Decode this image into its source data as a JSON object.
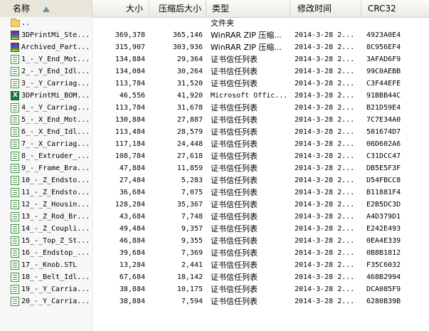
{
  "columns": {
    "name": "名称",
    "size": "大小",
    "packed": "压缩后大小",
    "type": "类型",
    "modified": "修改时间",
    "crc": "CRC32"
  },
  "rows": [
    {
      "name": "..",
      "size": "",
      "packed": "",
      "type": "文件夹",
      "modified": "",
      "crc": "",
      "icon": "folder-icon"
    },
    {
      "name": "3DPrintMi_Ste...",
      "size": "369,378",
      "packed": "365,146",
      "type": "WinRAR ZIP 压缩...",
      "modified": "2014-3-28 2...",
      "crc": "4923A0E4",
      "icon": "winrar-archive-icon"
    },
    {
      "name": "Archived_Part...",
      "size": "315,907",
      "packed": "303,936",
      "type": "WinRAR ZIP 压缩...",
      "modified": "2014-3-28 2...",
      "crc": "8C956EF4",
      "icon": "winrar-archive-icon"
    },
    {
      "name": "1_-_Y_End_Mot...",
      "size": "134,884",
      "packed": "29,364",
      "type": "证书信任列表",
      "modified": "2014-3-28 2...",
      "crc": "3AFAD6F9",
      "icon": "certificate-list-icon"
    },
    {
      "name": "2_-_Y_End_Idl...",
      "size": "134,084",
      "packed": "30,264",
      "type": "证书信任列表",
      "modified": "2014-3-28 2...",
      "crc": "99C0AEBB",
      "icon": "certificate-list-icon"
    },
    {
      "name": "3_-_Y_Carriag...",
      "size": "113,784",
      "packed": "31,520",
      "type": "证书信任列表",
      "modified": "2014-3-28 2...",
      "crc": "C3F44EFE",
      "icon": "certificate-list-icon"
    },
    {
      "name": "3DPrintMi_BOM...",
      "size": "46,556",
      "packed": "41,920",
      "type": "Microsoft Offic...",
      "modified": "2014-3-28 2...",
      "crc": "91BBB44C",
      "icon": "excel-file-icon"
    },
    {
      "name": "4_-_Y_Carriag...",
      "size": "113,784",
      "packed": "31,678",
      "type": "证书信任列表",
      "modified": "2014-3-28 2...",
      "crc": "B21D59E4",
      "icon": "certificate-list-icon"
    },
    {
      "name": "5_-_X_End_Mot...",
      "size": "130,884",
      "packed": "27,887",
      "type": "证书信任列表",
      "modified": "2014-3-28 2...",
      "crc": "7C7E34A0",
      "icon": "certificate-list-icon"
    },
    {
      "name": "6_-_X_End_Idl...",
      "size": "113,484",
      "packed": "28,579",
      "type": "证书信任列表",
      "modified": "2014-3-28 2...",
      "crc": "501674D7",
      "icon": "certificate-list-icon"
    },
    {
      "name": "7_-_X_Carriag...",
      "size": "117,184",
      "packed": "24,448",
      "type": "证书信任列表",
      "modified": "2014-3-28 2...",
      "crc": "06D602A6",
      "icon": "certificate-list-icon"
    },
    {
      "name": "8_-_Extruder_...",
      "size": "108,784",
      "packed": "27,618",
      "type": "证书信任列表",
      "modified": "2014-3-28 2...",
      "crc": "C31DCC47",
      "icon": "certificate-list-icon"
    },
    {
      "name": "9_-_Frame_Bra...",
      "size": "47,884",
      "packed": "11,859",
      "type": "证书信任列表",
      "modified": "2014-3-28 2...",
      "crc": "DB5E5F3F",
      "icon": "certificate-list-icon"
    },
    {
      "name": "10_-_Z_Endsto...",
      "size": "27,484",
      "packed": "5,283",
      "type": "证书信任列表",
      "modified": "2014-3-28 2...",
      "crc": "D54FBCC8",
      "icon": "certificate-list-icon"
    },
    {
      "name": "11_-_Z_Endsto...",
      "size": "36,684",
      "packed": "7,075",
      "type": "证书信任列表",
      "modified": "2014-3-28 2...",
      "crc": "B11881F4",
      "icon": "certificate-list-icon"
    },
    {
      "name": "12_-_Z_Housin...",
      "size": "128,284",
      "packed": "35,367",
      "type": "证书信任列表",
      "modified": "2014-3-28 2...",
      "crc": "E2B5DC3D",
      "icon": "certificate-list-icon"
    },
    {
      "name": "13_-_Z_Rod_Br...",
      "size": "43,684",
      "packed": "7,748",
      "type": "证书信任列表",
      "modified": "2014-3-28 2...",
      "crc": "A4D379D1",
      "icon": "certificate-list-icon"
    },
    {
      "name": "14_-_Z_Coupli...",
      "size": "49,484",
      "packed": "9,357",
      "type": "证书信任列表",
      "modified": "2014-3-28 2...",
      "crc": "E242E493",
      "icon": "certificate-list-icon"
    },
    {
      "name": "15_-_Top_Z_St...",
      "size": "46,884",
      "packed": "9,355",
      "type": "证书信任列表",
      "modified": "2014-3-28 2...",
      "crc": "0EA4E339",
      "icon": "certificate-list-icon"
    },
    {
      "name": "16_-_Endstop_...",
      "size": "39,684",
      "packed": "7,369",
      "type": "证书信任列表",
      "modified": "2014-3-28 2...",
      "crc": "0B8B1812",
      "icon": "certificate-list-icon"
    },
    {
      "name": "17_-_Knob.STL",
      "size": "13,284",
      "packed": "2,441",
      "type": "证书信任列表",
      "modified": "2014-3-28 2...",
      "crc": "F35C6032",
      "icon": "certificate-list-icon"
    },
    {
      "name": "18_-_Belt_Idl...",
      "size": "67,684",
      "packed": "18,142",
      "type": "证书信任列表",
      "modified": "2014-3-28 2...",
      "crc": "468B2994",
      "icon": "certificate-list-icon"
    },
    {
      "name": "19_-_Y_Carria...",
      "size": "38,884",
      "packed": "10,175",
      "type": "证书信任列表",
      "modified": "2014-3-28 2...",
      "crc": "DCA085F9",
      "icon": "certificate-list-icon"
    },
    {
      "name": "20_-_Y_Carria...",
      "size": "38,884",
      "packed": "7,594",
      "type": "证书信任列表",
      "modified": "2014-3-28 2...",
      "crc": "6280B39B",
      "icon": "certificate-list-icon"
    }
  ]
}
